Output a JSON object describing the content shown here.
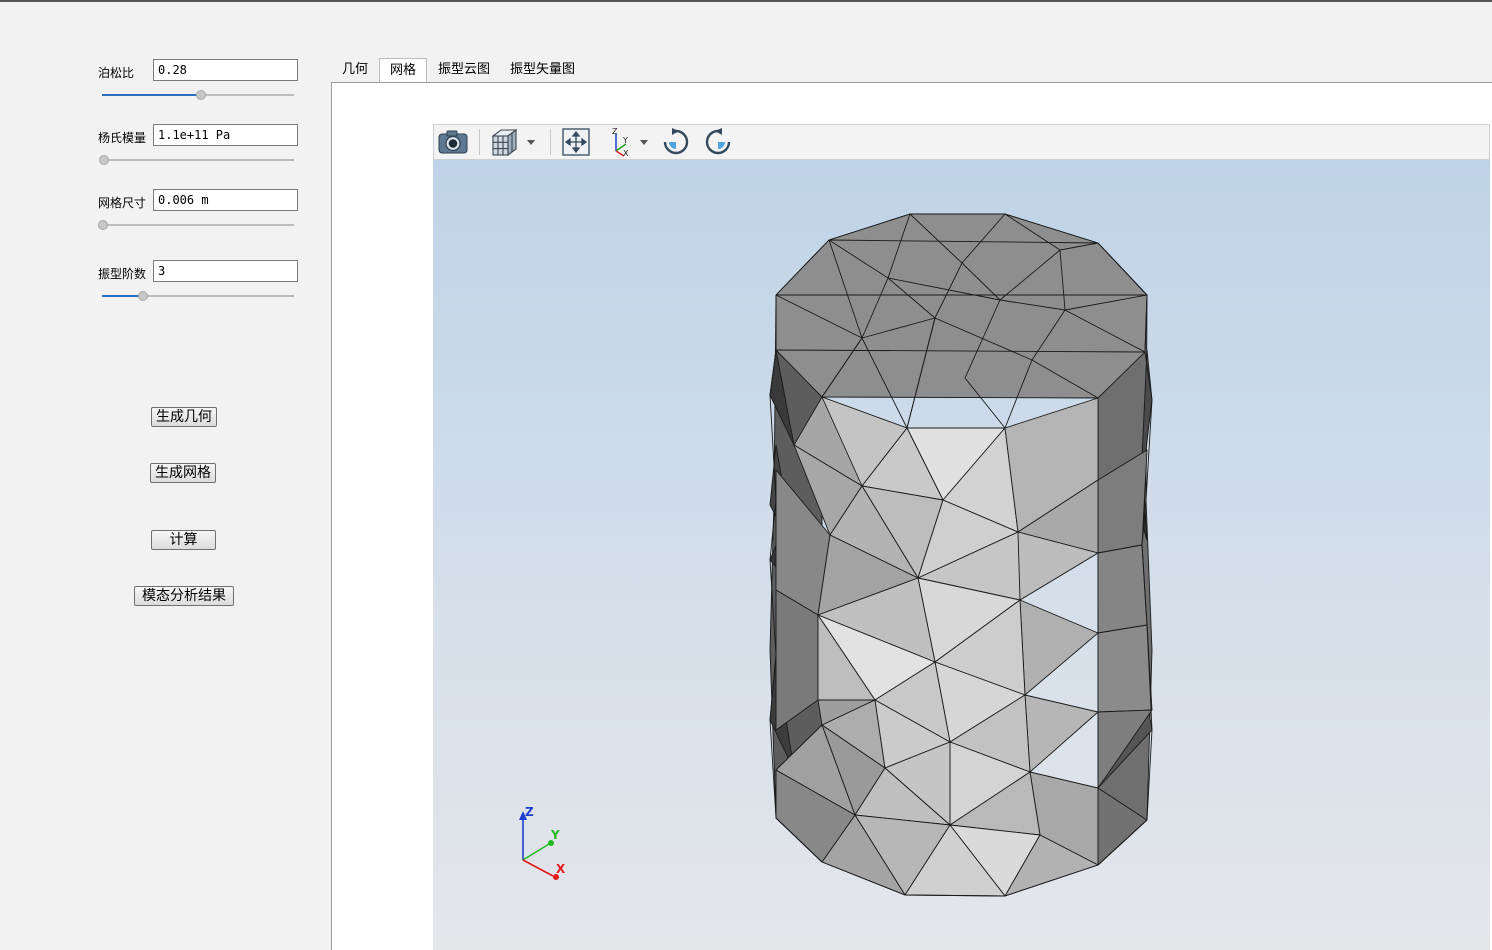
{
  "params": [
    {
      "label": "泊松比",
      "value": "0.28",
      "slider": 0.5
    },
    {
      "label": "杨氏模量",
      "value": "1.1e+11 Pa",
      "slider": 0.0
    },
    {
      "label": "网格尺寸",
      "value": "0.006 m",
      "slider": 0.0
    },
    {
      "label": "振型阶数",
      "value": "3",
      "slider": 0.2
    }
  ],
  "buttons": {
    "gen_geometry": "生成几何",
    "gen_mesh": "生成网格",
    "compute": "计算",
    "modal_result": "模态分析结果"
  },
  "tabs": [
    {
      "label": "几何",
      "active": false
    },
    {
      "label": "网格",
      "active": true
    },
    {
      "label": "振型云图",
      "active": false
    },
    {
      "label": "振型矢量图",
      "active": false
    }
  ],
  "toolbar": {
    "icons": [
      "camera-icon",
      "view-cube-icon",
      "fit-all-icon",
      "axes-icon",
      "rotate-cw-icon",
      "rotate-ccw-icon"
    ],
    "axes_icon_labels": {
      "z": "Z",
      "y": "Y",
      "x": "X"
    }
  },
  "triad": {
    "z": "Z",
    "y": "Y",
    "x": "X"
  },
  "colors": {
    "accent": "#2a6fbf",
    "mesh_top": "#8e8e8e",
    "mesh_front": "#cdcdcd",
    "mesh_side": "#6e6e6e",
    "axis_x": "#e01b1b",
    "axis_y": "#22bb22",
    "axis_z": "#1f3fd1"
  }
}
